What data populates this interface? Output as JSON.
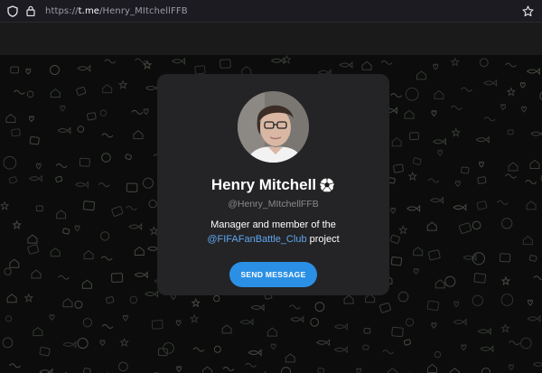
{
  "browser": {
    "url_prefix": "https://",
    "url_host": "t.me",
    "url_path": "/Henry_MItchellFFB"
  },
  "profile": {
    "name": "Henry Mitchell",
    "name_emoji_icon": "soccer-ball-icon",
    "username": "@Henry_MItchellFFB",
    "bio_before": "Manager and member of the ",
    "bio_mention": "@FIFAFanBattle_Club",
    "bio_after": " project",
    "button_label": "SEND MESSAGE"
  },
  "colors": {
    "accent": "#2b90e5",
    "link": "#5ea6f0",
    "card": "#242426",
    "background": "#0b0c0b"
  },
  "icons": [
    "shield-icon",
    "lock-icon",
    "star-icon",
    "soccer-ball-icon"
  ]
}
